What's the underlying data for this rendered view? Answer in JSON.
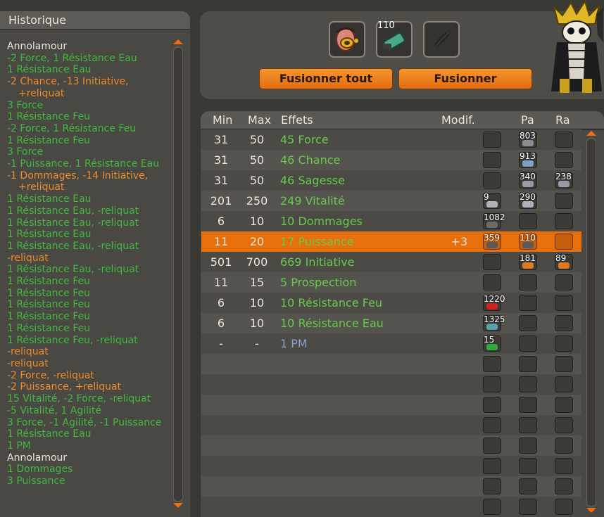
{
  "history": {
    "title": "Historique",
    "entries": [
      {
        "text": "Annolamour",
        "color": "white"
      },
      {
        "text": "-2 Force, 1 Résistance Eau",
        "color": "green"
      },
      {
        "text": "1 Résistance Eau",
        "color": "green"
      },
      {
        "text": "-2 Chance, -13 Initiative,",
        "color": "orange"
      },
      {
        "text": "+reliquat",
        "color": "orange",
        "indent": true
      },
      {
        "text": "3 Force",
        "color": "green"
      },
      {
        "text": "1 Résistance Feu",
        "color": "green"
      },
      {
        "text": "-2 Force, 1 Résistance Feu",
        "color": "green"
      },
      {
        "text": "1 Résistance Feu",
        "color": "green"
      },
      {
        "text": "3 Force",
        "color": "green"
      },
      {
        "text": "-1 Puissance, 1 Résistance Eau",
        "color": "green"
      },
      {
        "text": "-1 Dommages, -14 Initiative,",
        "color": "orange"
      },
      {
        "text": "+reliquat",
        "color": "orange",
        "indent": true
      },
      {
        "text": "1 Résistance Eau",
        "color": "green"
      },
      {
        "text": "1 Résistance Eau, -reliquat",
        "color": "green"
      },
      {
        "text": "1 Résistance Eau, -reliquat",
        "color": "green"
      },
      {
        "text": "1 Résistance Eau",
        "color": "green"
      },
      {
        "text": "1 Résistance Eau, -reliquat",
        "color": "green"
      },
      {
        "text": "-reliquat",
        "color": "orange"
      },
      {
        "text": "1 Résistance Eau, -reliquat",
        "color": "green"
      },
      {
        "text": "1 Résistance Feu",
        "color": "green"
      },
      {
        "text": "1 Résistance Feu",
        "color": "green"
      },
      {
        "text": "1 Résistance Feu",
        "color": "green"
      },
      {
        "text": "1 Résistance Feu",
        "color": "green"
      },
      {
        "text": "1 Résistance Feu",
        "color": "green"
      },
      {
        "text": "1 Résistance Feu, -reliquat",
        "color": "green"
      },
      {
        "text": "-reliquat",
        "color": "orange"
      },
      {
        "text": "-reliquat",
        "color": "orange"
      },
      {
        "text": "-2 Force, -reliquat",
        "color": "orange"
      },
      {
        "text": "-2 Puissance, +reliquat",
        "color": "orange"
      },
      {
        "text": "15 Vitalité, -2 Force, -reliquat",
        "color": "green"
      },
      {
        "text": "-5 Vitalité, 1 Agilité",
        "color": "green"
      },
      {
        "text": "3 Force, -1 Agilité, -1 Puissance",
        "color": "green"
      },
      {
        "text": "1 Résistance Eau",
        "color": "green"
      },
      {
        "text": "1 PM",
        "color": "green"
      },
      {
        "text": "Annolamour",
        "color": "white"
      },
      {
        "text": "1 Dommages",
        "color": "green"
      },
      {
        "text": "3 Puissance",
        "color": "green"
      }
    ]
  },
  "forge": {
    "slot_count": "110",
    "buttons": {
      "merge_all": "Fusionner tout",
      "merge": "Fusionner"
    }
  },
  "table": {
    "headers": {
      "min": "Min",
      "max": "Max",
      "effects": "Effets",
      "modif": "Modif.",
      "pa": "Pa",
      "ra": "Ra"
    },
    "rows": [
      {
        "min": "31",
        "max": "50",
        "effect": "45 Force",
        "modif": "",
        "mod_count": "",
        "pa_count": "803",
        "ra_count": "",
        "rune_color": "#8c8c90"
      },
      {
        "min": "31",
        "max": "50",
        "effect": "46 Chance",
        "modif": "",
        "mod_count": "",
        "pa_count": "913",
        "ra_count": "",
        "rune_color": "#7aa0c8"
      },
      {
        "min": "31",
        "max": "50",
        "effect": "46 Sagesse",
        "modif": "",
        "mod_count": "",
        "pa_count": "340",
        "ra_count": "238",
        "rune_color": "#9a9aa4"
      },
      {
        "min": "201",
        "max": "250",
        "effect": "249 Vitalité",
        "modif": "",
        "mod_count": "9",
        "pa_count": "290",
        "ra_count": "",
        "rune_color": "#b0b0b8"
      },
      {
        "min": "6",
        "max": "10",
        "effect": "10 Dommages",
        "modif": "",
        "mod_count": "1082",
        "pa_count": "",
        "ra_count": "",
        "rune_color": "#6a6a6a"
      },
      {
        "min": "11",
        "max": "20",
        "effect": "17 Puissance",
        "modif": "+3",
        "mod_count": "359",
        "pa_count": "110",
        "ra_count": "",
        "rune_color": "#5a5a5a",
        "highlight": true
      },
      {
        "min": "501",
        "max": "700",
        "effect": "669 Initiative",
        "modif": "",
        "mod_count": "",
        "pa_count": "181",
        "ra_count": "89",
        "rune_color": "#e07a20"
      },
      {
        "min": "11",
        "max": "15",
        "effect": "5 Prospection",
        "modif": "",
        "mod_count": "",
        "pa_count": "",
        "ra_count": "",
        "rune_color": ""
      },
      {
        "min": "6",
        "max": "10",
        "effect": "10 Résistance Feu",
        "modif": "",
        "mod_count": "1220",
        "pa_count": "",
        "ra_count": "",
        "rune_color": "#d02020"
      },
      {
        "min": "6",
        "max": "10",
        "effect": "10 Résistance Eau",
        "modif": "",
        "mod_count": "1325",
        "pa_count": "",
        "ra_count": "",
        "rune_color": "#5aa0a8"
      },
      {
        "min": "-",
        "max": "-",
        "effect": "1 PM",
        "modif": "",
        "mod_count": "15",
        "pa_count": "",
        "ra_count": "",
        "rune_color": "#2faa3a",
        "pm": true
      }
    ],
    "empty_rows": 8
  }
}
